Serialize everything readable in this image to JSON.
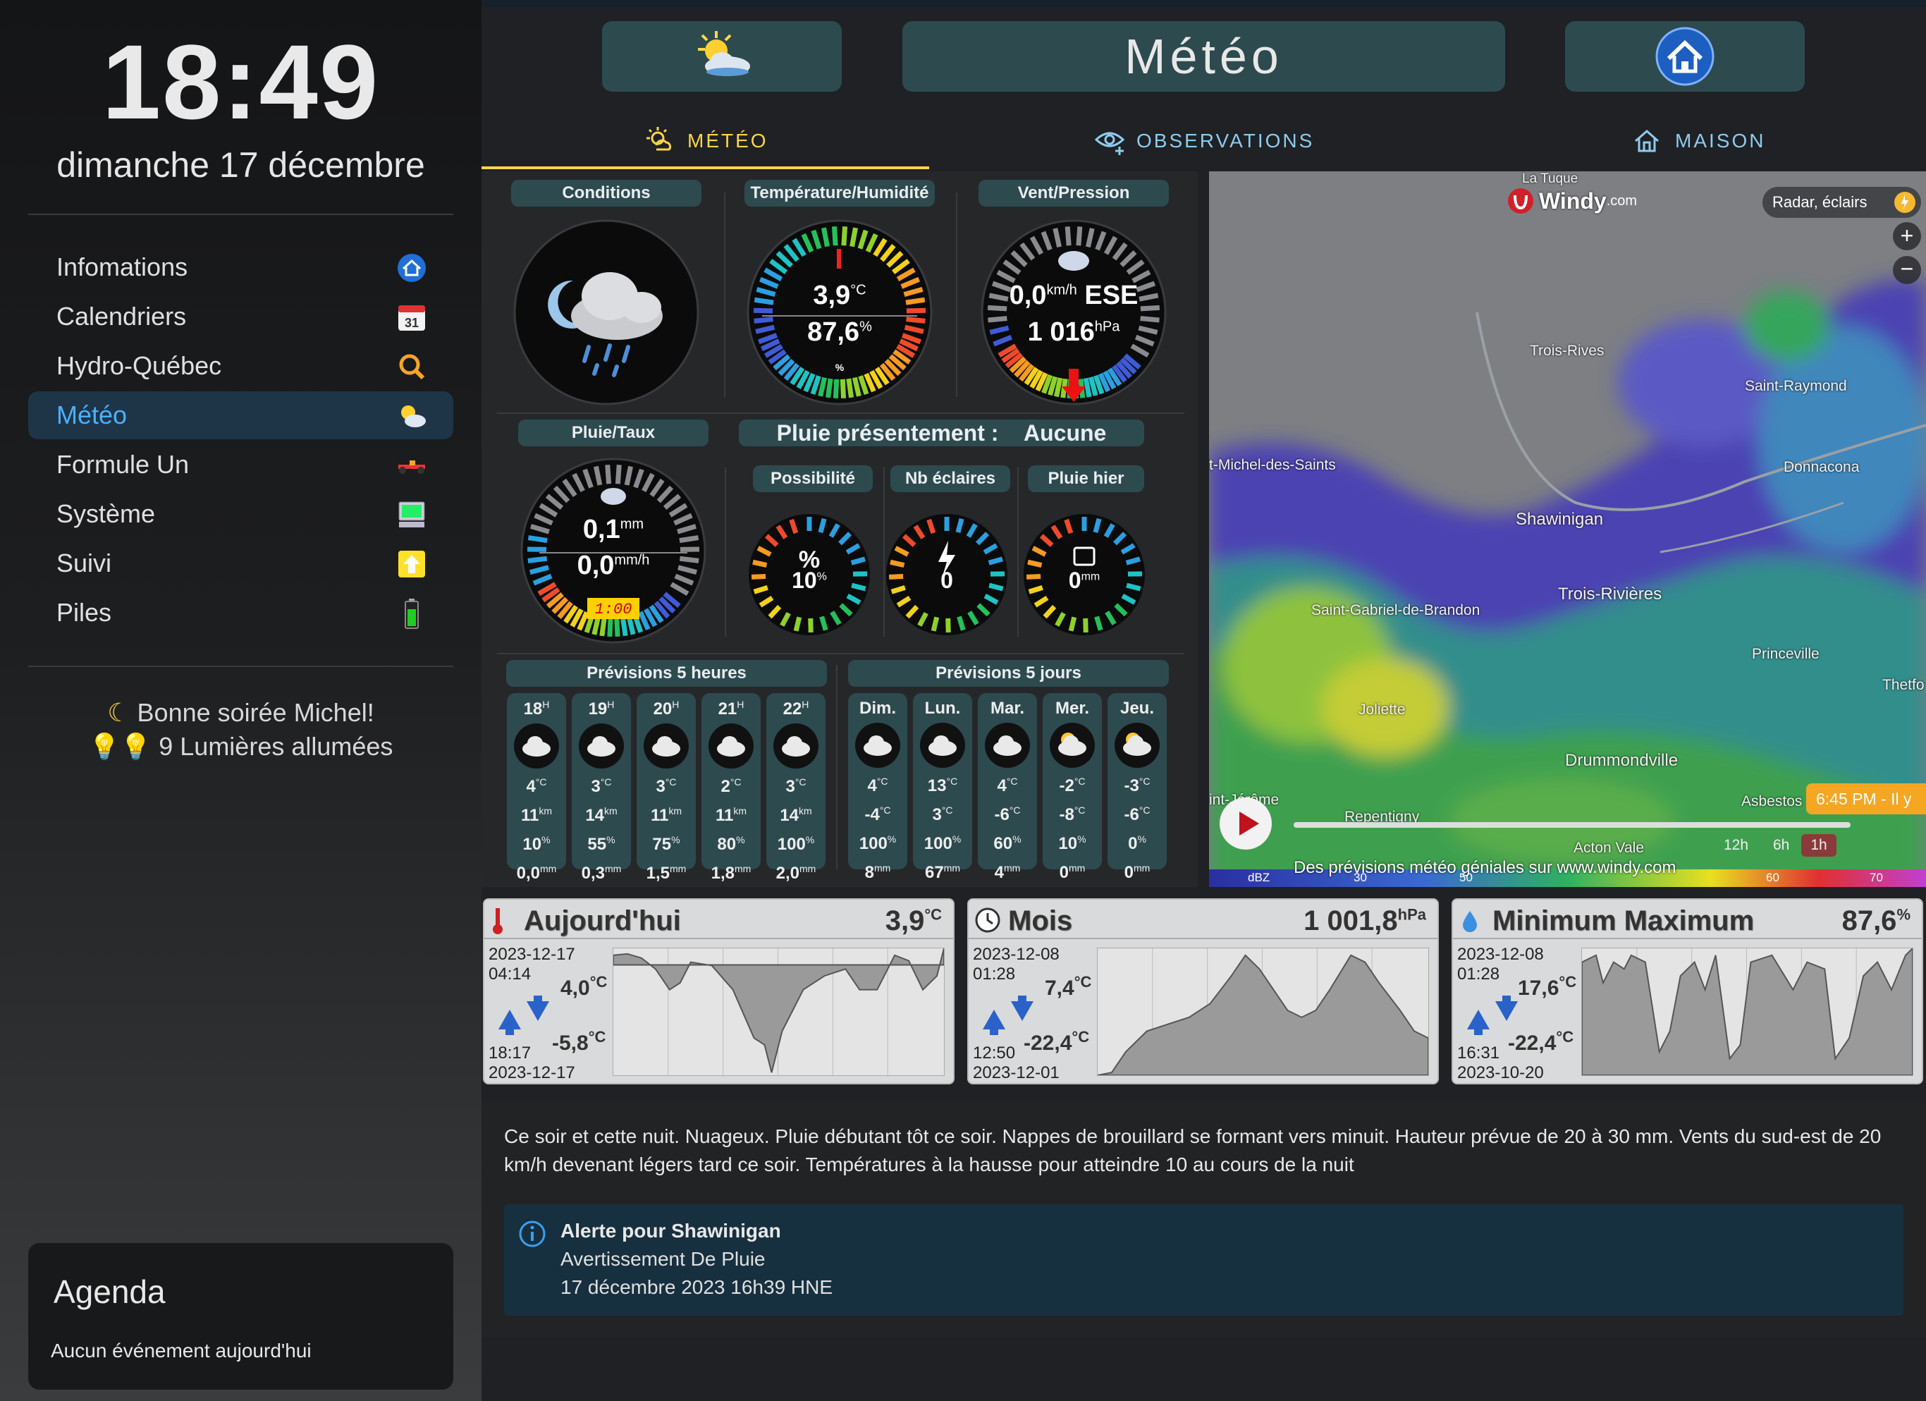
{
  "sidebar": {
    "time": "18:49",
    "date": "dimanche 17 décembre",
    "items": [
      {
        "label": "Infomations",
        "icon": "home-icon"
      },
      {
        "label": "Calendriers",
        "icon": "calendar-icon",
        "badge": "31"
      },
      {
        "label": "Hydro-Québec",
        "icon": "hydro-icon"
      },
      {
        "label": "Météo",
        "icon": "weather-icon",
        "active": true
      },
      {
        "label": "Formule Un",
        "icon": "f1-car-icon"
      },
      {
        "label": "Système",
        "icon": "computer-icon"
      },
      {
        "label": "Suivi",
        "icon": "arrow-up-icon"
      },
      {
        "label": "Piles",
        "icon": "battery-icon"
      }
    ],
    "greeting": "Bonne soirée Michel!",
    "lights": "9 Lumières allumées",
    "agenda": {
      "title": "Agenda",
      "empty": "Aucun événement aujourd'hui"
    }
  },
  "header": {
    "title": "Météo",
    "tabs": [
      {
        "label": "MÉTÉO",
        "active": true
      },
      {
        "label": "OBSERVATIONS"
      },
      {
        "label": "MAISON"
      }
    ]
  },
  "conditions": {
    "label_conditions": "Conditions",
    "label_temp": "Température/Humidité",
    "label_wind": "Vent/Pression",
    "temp": "3,9",
    "temp_unit": "°C",
    "humidity": "87,6",
    "humidity_unit": "%",
    "humidity_small": "%",
    "wind": "0,0",
    "wind_unit": "km/h",
    "wind_dir": "ESE",
    "pressure": "1 016",
    "pressure_unit": "hPa"
  },
  "rain": {
    "label_rate": "Pluie/Taux",
    "rain": "0,1",
    "rain_unit": "mm",
    "rate": "0,0",
    "rate_unit": "mm/h",
    "time": "1:00",
    "now_label": "Pluie présentement :",
    "now_value": "Aucune",
    "label_possibility": "Possibilité",
    "possibility": "10",
    "possibility_unit": "%",
    "label_lightning": "Nb éclaires",
    "lightning": "0",
    "label_yesterday": "Pluie hier",
    "yesterday": "0",
    "yesterday_unit": "mm"
  },
  "forecast_hours": {
    "label": "Prévisions 5 heures",
    "cols": [
      {
        "h": "18",
        "hu": "H",
        "t": "4",
        "w": "11",
        "p": "10",
        "r": "0,0"
      },
      {
        "h": "19",
        "hu": "H",
        "t": "3",
        "w": "14",
        "p": "55",
        "r": "0,3"
      },
      {
        "h": "20",
        "hu": "H",
        "t": "3",
        "w": "11",
        "p": "75",
        "r": "1,5"
      },
      {
        "h": "21",
        "hu": "H",
        "t": "2",
        "w": "11",
        "p": "80",
        "r": "1,8"
      },
      {
        "h": "22",
        "hu": "H",
        "t": "3",
        "w": "14",
        "p": "100",
        "r": "2,0"
      }
    ]
  },
  "forecast_days": {
    "label": "Prévisions 5 jours",
    "cols": [
      {
        "d": "Dim.",
        "hi": "4",
        "lo": "-4",
        "p": "100",
        "r": "8"
      },
      {
        "d": "Lun.",
        "hi": "13",
        "lo": "3",
        "p": "100",
        "r": "67"
      },
      {
        "d": "Mar.",
        "hi": "4",
        "lo": "-6",
        "p": "60",
        "r": "4"
      },
      {
        "d": "Mer.",
        "hi": "-2",
        "lo": "-8",
        "p": "10",
        "r": "0"
      },
      {
        "d": "Jeu.",
        "hi": "-3",
        "lo": "-6",
        "p": "0",
        "r": "0"
      }
    ]
  },
  "map": {
    "brand": "Windy",
    "brand_suffix": ".com",
    "layer": "Radar, éclairs",
    "top_label": "La Tuque",
    "cities": [
      {
        "name": "Trois-Rives"
      },
      {
        "name": "Saint-Raymond"
      },
      {
        "name": "t-Michel-des-Saints"
      },
      {
        "name": "Donnacona"
      },
      {
        "name": "Shawinigan"
      },
      {
        "name": "Trois-Rivières"
      },
      {
        "name": "Saint-Gabriel-de-Brandon"
      },
      {
        "name": "Princeville"
      },
      {
        "name": "Joliette"
      },
      {
        "name": "Thetfo"
      },
      {
        "name": "Drummondville"
      },
      {
        "name": "int-Jérôme"
      },
      {
        "name": "Repentigny"
      },
      {
        "name": "Asbestos"
      },
      {
        "name": "Acton Vale"
      }
    ],
    "time_badge": "6:45 PM - Il y",
    "durations": [
      "12h",
      "6h",
      "1h"
    ],
    "footer": "Des prévisions météo géniales sur www.windy.com",
    "scale_unit": "dBZ",
    "scale": [
      "30",
      "50",
      "60",
      "70"
    ]
  },
  "cards": [
    {
      "title": "Aujourd'hui",
      "value": "3,9",
      "unit": "°C",
      "icon": "thermometer-icon",
      "d1": "2023-12-17",
      "t1": "04:14",
      "max": "4,0",
      "min": "-5,8",
      "t2": "18:17",
      "d2": "2023-12-17",
      "munit": "°C"
    },
    {
      "title": "Mois",
      "value": "1 001,8",
      "unit": "hPa",
      "icon": "clock-icon",
      "d1": "2023-12-08",
      "t1": "01:28",
      "max": "7,4",
      "min": "-22,4",
      "t2": "12:50",
      "d2": "2023-12-01",
      "munit": "°C"
    },
    {
      "title": "Minimum Maximum",
      "value": "87,6",
      "unit": "%",
      "icon": "droplet-icon",
      "d1": "2023-12-08",
      "t1": "01:28",
      "max": "17,6",
      "min": "-22,4",
      "t2": "16:31",
      "d2": "2023-10-20",
      "munit": "°C"
    }
  ],
  "forecast_text": "Ce soir et cette nuit. Nuageux. Pluie débutant tôt ce soir. Nappes de brouillard se formant vers minuit. Hauteur prévue de 20 à 30 mm. Vents du sud-est de 20 km/h devenant légers tard ce soir. Températures à la hausse pour atteindre 10 au cours de la nuit",
  "alert": {
    "title": "Alerte pour Shawinigan",
    "type": "Avertissement De Pluie",
    "when": "17 décembre 2023 16h39 HNE"
  }
}
